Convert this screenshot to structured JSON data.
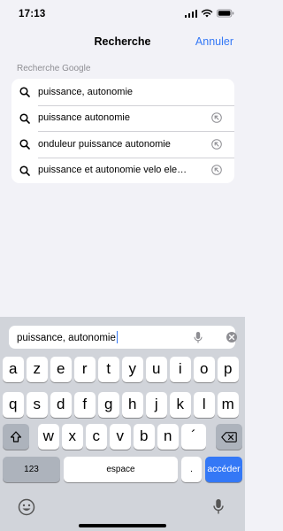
{
  "status": {
    "time": "17:13"
  },
  "nav": {
    "title": "Recherche",
    "cancel": "Annuler"
  },
  "section_header": "Recherche Google",
  "suggestions": [
    {
      "text": "puissance, autonomie",
      "icon": "search-icon",
      "action": ""
    },
    {
      "text": "puissance autonomie",
      "icon": "search-icon",
      "action": "fill-arrow-icon"
    },
    {
      "text": "onduleur puissance autonomie",
      "icon": "search-icon",
      "action": "fill-arrow-icon"
    },
    {
      "text": "puissance et autonomie velo ele…",
      "icon": "search-icon",
      "action": "fill-arrow-icon"
    }
  ],
  "search_field": {
    "value": "puissance, autonomie"
  },
  "keyboard": {
    "row1": [
      "a",
      "z",
      "e",
      "r",
      "t",
      "y",
      "u",
      "i",
      "o",
      "p"
    ],
    "row2": [
      "q",
      "s",
      "d",
      "f",
      "g",
      "h",
      "j",
      "k",
      "l",
      "m"
    ],
    "row3": [
      "w",
      "x",
      "c",
      "v",
      "b",
      "n",
      "´"
    ],
    "numbers": "123",
    "space": "espace",
    "period": ".",
    "go": "accéder"
  },
  "colors": {
    "accent": "#3478f6",
    "background": "#f2f2f7",
    "keyboard": "#d1d4da"
  }
}
